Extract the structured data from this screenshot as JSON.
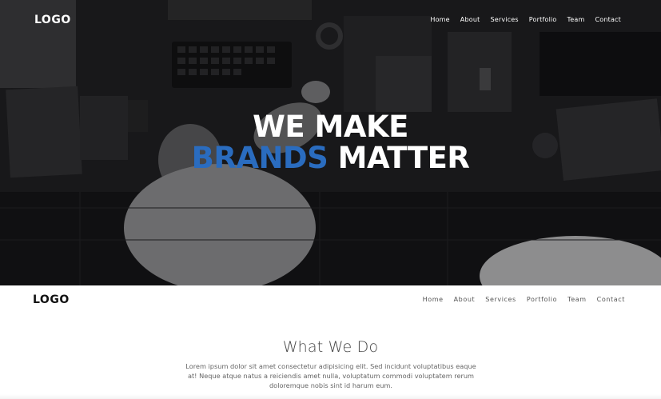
{
  "hero": {
    "logo": "LOGO",
    "nav": [
      "Home",
      "About",
      "Services",
      "Portfolio",
      "Team",
      "Contact"
    ],
    "headline_line1": "WE MAKE",
    "headline_accent": "BRANDS",
    "headline_rest": "MATTER",
    "accent_color": "#2a6cbf",
    "background_image": "overhead-office-desk-photo"
  },
  "header": {
    "logo": "LOGO",
    "nav": [
      "Home",
      "About",
      "Services",
      "Portfolio",
      "Team",
      "Contact"
    ]
  },
  "what_we_do": {
    "title": "What We Do",
    "text": "Lorem ipsum dolor sit amet consectetur adipisicing elit. Sed incidunt voluptatibus eaque at! Neque atque natus a reiciendis amet nulla, voluptatum commodi voluptatem rerum doloremque nobis sint id harum eum."
  }
}
